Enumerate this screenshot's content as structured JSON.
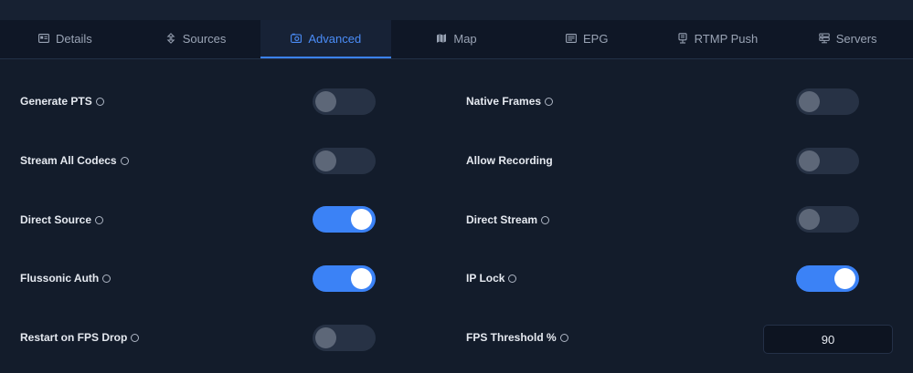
{
  "tabs": [
    {
      "label": "Details",
      "icon": "id-card-icon"
    },
    {
      "label": "Sources",
      "icon": "arrows-icon"
    },
    {
      "label": "Advanced",
      "icon": "gears-icon"
    },
    {
      "label": "Map",
      "icon": "map-icon"
    },
    {
      "label": "EPG",
      "icon": "tv-guide-icon"
    },
    {
      "label": "RTMP Push",
      "icon": "broadcast-icon"
    },
    {
      "label": "Servers",
      "icon": "server-icon"
    }
  ],
  "active_tab": "Advanced",
  "settings": {
    "generate_pts": {
      "label": "Generate PTS",
      "on": false
    },
    "native_frames": {
      "label": "Native Frames",
      "on": false
    },
    "stream_all_codecs": {
      "label": "Stream All Codecs",
      "on": false
    },
    "allow_recording": {
      "label": "Allow Recording",
      "on": false
    },
    "direct_source": {
      "label": "Direct Source",
      "on": true
    },
    "direct_stream": {
      "label": "Direct Stream",
      "on": false
    },
    "flussonic_auth": {
      "label": "Flussonic Auth",
      "on": true
    },
    "ip_lock": {
      "label": "IP Lock",
      "on": true
    },
    "restart_on_fps_drop": {
      "label": "Restart on FPS Drop",
      "on": false
    },
    "fps_threshold": {
      "label": "FPS Threshold %",
      "value": "90"
    }
  },
  "colors": {
    "accent": "#3b82f6",
    "background": "#131c2b",
    "toggle_off": "#273245"
  }
}
